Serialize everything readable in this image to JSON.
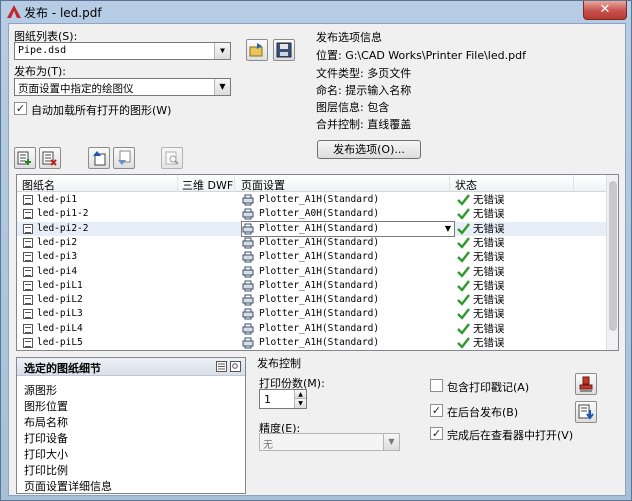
{
  "window": {
    "title": "发布 - led.pdf",
    "close_glyph": "✕"
  },
  "sheet_list": {
    "label": "图纸列表(S):",
    "value": "Pipe.dsd"
  },
  "publish_to": {
    "label": "发布为(T):",
    "value": "页面设置中指定的绘图仪"
  },
  "auto_load": {
    "label": "自动加载所有打开的图形(W)",
    "checked": true
  },
  "options_info": {
    "title": "发布选项信息",
    "lines": [
      "位置: G:\\CAD Works\\Printer File\\led.pdf",
      "文件类型: 多页文件",
      "命名: 提示输入名称",
      "图层信息: 包含",
      "合并控制: 直线覆盖"
    ],
    "button_label": "发布选项(O)..."
  },
  "table": {
    "columns": [
      "图纸名",
      "三维 DWF",
      "页面设置",
      "状态"
    ],
    "rows": [
      {
        "name": "led-pi1",
        "setup": "Plotter_A1H(Standard)",
        "status": "无错误"
      },
      {
        "name": "led-pi1-2",
        "setup": "Plotter_A0H(Standard)",
        "status": "无错误"
      },
      {
        "name": "led-pi2-2",
        "setup": "Plotter_A1H(Standard)",
        "status": "无错误",
        "selected": true
      },
      {
        "name": "led-pi2",
        "setup": "Plotter_A1H(Standard)",
        "status": "无错误"
      },
      {
        "name": "led-pi3",
        "setup": "Plotter_A1H(Standard)",
        "status": "无错误"
      },
      {
        "name": "led-pi4",
        "setup": "Plotter_A1H(Standard)",
        "status": "无错误"
      },
      {
        "name": "led-piL1",
        "setup": "Plotter_A1H(Standard)",
        "status": "无错误"
      },
      {
        "name": "led-piL2",
        "setup": "Plotter_A1H(Standard)",
        "status": "无错误"
      },
      {
        "name": "led-piL3",
        "setup": "Plotter_A1H(Standard)",
        "status": "无错误"
      },
      {
        "name": "led-piL4",
        "setup": "Plotter_A1H(Standard)",
        "status": "无错误"
      },
      {
        "name": "led-piL5",
        "setup": "Plotter_A1H(Standard)",
        "status": "无错误"
      }
    ]
  },
  "details": {
    "title": "选定的图纸细节",
    "items": [
      "源图形",
      "图形位置",
      "布局名称",
      "打印设备",
      "打印大小",
      "打印比例",
      "页面设置详细信息"
    ]
  },
  "publish_control": {
    "title": "发布控制",
    "copies_label": "打印份数(M):",
    "copies_value": "1",
    "precision_label": "精度(E):",
    "precision_value": "无",
    "include_stamp": {
      "label": "包含打印戳记(A)",
      "checked": false
    },
    "background": {
      "label": "在后台发布(B)",
      "checked": true
    },
    "open_viewer": {
      "label": "完成后在查看器中打开(V)",
      "checked": true
    }
  },
  "colors": {
    "check_green": "#2e9a2e",
    "title_bar": "#b7cde6",
    "close_red": "#c75050"
  }
}
